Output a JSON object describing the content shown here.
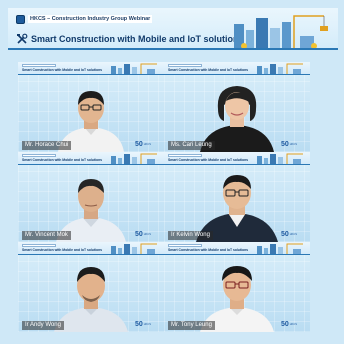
{
  "banner": {
    "org_line": "HKCS – Construction Industry Group Webinar",
    "title": "Smart Construction with Mobile and IoT solutions"
  },
  "tile_header_title": "Smart Construction with Mobile and IoT solutions",
  "anniversary": {
    "number": "50",
    "caption": "HKCS"
  },
  "participants": [
    {
      "name": "Mr. Horace Chui"
    },
    {
      "name": "Ms. Cari Leung"
    },
    {
      "name": "Mr. Vincent Mok"
    },
    {
      "name": "Ir Kelvin Wong"
    },
    {
      "name": "Ir Andy Wong"
    },
    {
      "name": "Mr. Tony Leung"
    }
  ],
  "colors": {
    "banner_blue": "#2b78b5",
    "title_navy": "#123b6b",
    "background": "#cfe8f7"
  }
}
